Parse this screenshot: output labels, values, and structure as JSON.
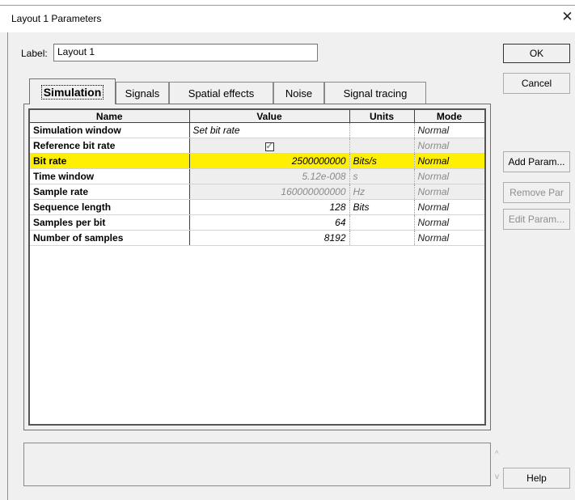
{
  "window": {
    "title": "Layout 1 Parameters",
    "close_glyph": "✕"
  },
  "label_field": {
    "label": "Label:",
    "value": "Layout 1"
  },
  "buttons": {
    "ok": "OK",
    "cancel": "Cancel",
    "add_param": "Add Param...",
    "remove_par": "Remove Par",
    "edit_param": "Edit Param...",
    "help": "Help"
  },
  "tabs": [
    {
      "label": "Simulation",
      "active": true
    },
    {
      "label": "Signals",
      "active": false
    },
    {
      "label": "Spatial effects",
      "active": false
    },
    {
      "label": "Noise",
      "active": false
    },
    {
      "label": "Signal tracing",
      "active": false
    }
  ],
  "grid": {
    "columns": [
      "Name",
      "Value",
      "Units",
      "Mode"
    ],
    "rows": [
      {
        "name": "Simulation window",
        "value": "Set bit rate",
        "units": "",
        "mode": "Normal",
        "state": "normal",
        "align": "left"
      },
      {
        "name": "Reference bit rate",
        "value": "✓",
        "units": "",
        "mode": "Normal",
        "state": "gray",
        "checkbox": true
      },
      {
        "name": "Bit rate",
        "value": "2500000000",
        "units": "Bits/s",
        "mode": "Normal",
        "state": "selected"
      },
      {
        "name": "Time window",
        "value": "5.12e-008",
        "units": "s",
        "mode": "Normal",
        "state": "gray"
      },
      {
        "name": "Sample rate",
        "value": "160000000000",
        "units": "Hz",
        "mode": "Normal",
        "state": "gray"
      },
      {
        "name": "Sequence length",
        "value": "128",
        "units": "Bits",
        "mode": "Normal",
        "state": "normal"
      },
      {
        "name": "Samples per bit",
        "value": "64",
        "units": "",
        "mode": "Normal",
        "state": "normal"
      },
      {
        "name": "Number of samples",
        "value": "8192",
        "units": "",
        "mode": "Normal",
        "state": "normal"
      }
    ]
  },
  "description_box": {
    "up_glyph": "^",
    "down_glyph": "v"
  },
  "colors": {
    "selection": "#ffef00",
    "background": "#f0f0f0"
  }
}
